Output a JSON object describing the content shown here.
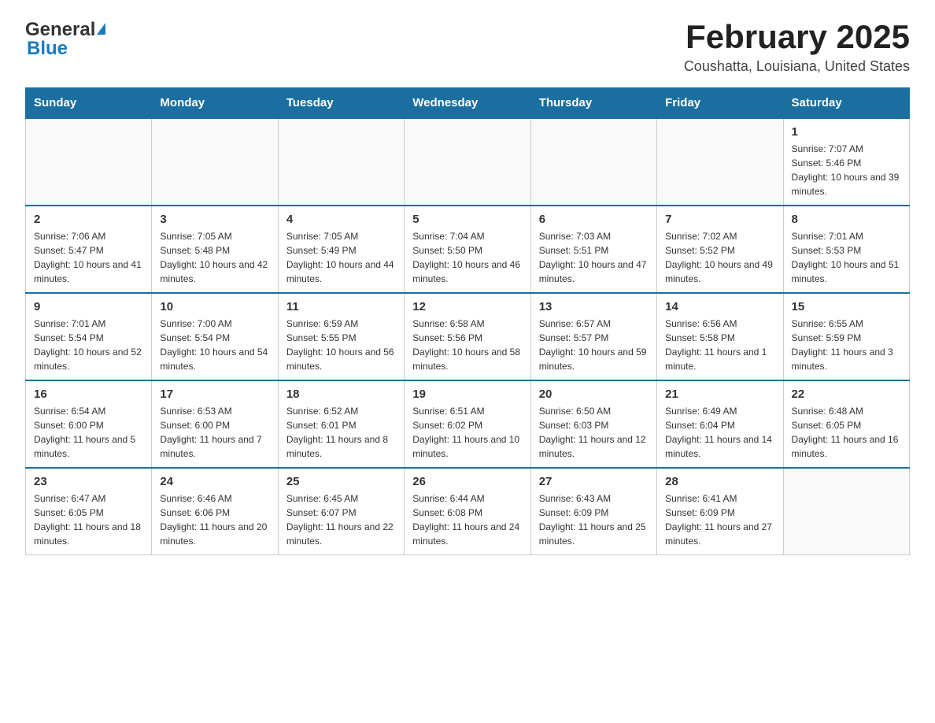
{
  "logo": {
    "general": "General",
    "blue": "Blue",
    "triangle": "▲"
  },
  "title": "February 2025",
  "subtitle": "Coushatta, Louisiana, United States",
  "days_of_week": [
    "Sunday",
    "Monday",
    "Tuesday",
    "Wednesday",
    "Thursday",
    "Friday",
    "Saturday"
  ],
  "weeks": [
    [
      {
        "day": "",
        "info": ""
      },
      {
        "day": "",
        "info": ""
      },
      {
        "day": "",
        "info": ""
      },
      {
        "day": "",
        "info": ""
      },
      {
        "day": "",
        "info": ""
      },
      {
        "day": "",
        "info": ""
      },
      {
        "day": "1",
        "info": "Sunrise: 7:07 AM\nSunset: 5:46 PM\nDaylight: 10 hours and 39 minutes."
      }
    ],
    [
      {
        "day": "2",
        "info": "Sunrise: 7:06 AM\nSunset: 5:47 PM\nDaylight: 10 hours and 41 minutes."
      },
      {
        "day": "3",
        "info": "Sunrise: 7:05 AM\nSunset: 5:48 PM\nDaylight: 10 hours and 42 minutes."
      },
      {
        "day": "4",
        "info": "Sunrise: 7:05 AM\nSunset: 5:49 PM\nDaylight: 10 hours and 44 minutes."
      },
      {
        "day": "5",
        "info": "Sunrise: 7:04 AM\nSunset: 5:50 PM\nDaylight: 10 hours and 46 minutes."
      },
      {
        "day": "6",
        "info": "Sunrise: 7:03 AM\nSunset: 5:51 PM\nDaylight: 10 hours and 47 minutes."
      },
      {
        "day": "7",
        "info": "Sunrise: 7:02 AM\nSunset: 5:52 PM\nDaylight: 10 hours and 49 minutes."
      },
      {
        "day": "8",
        "info": "Sunrise: 7:01 AM\nSunset: 5:53 PM\nDaylight: 10 hours and 51 minutes."
      }
    ],
    [
      {
        "day": "9",
        "info": "Sunrise: 7:01 AM\nSunset: 5:54 PM\nDaylight: 10 hours and 52 minutes."
      },
      {
        "day": "10",
        "info": "Sunrise: 7:00 AM\nSunset: 5:54 PM\nDaylight: 10 hours and 54 minutes."
      },
      {
        "day": "11",
        "info": "Sunrise: 6:59 AM\nSunset: 5:55 PM\nDaylight: 10 hours and 56 minutes."
      },
      {
        "day": "12",
        "info": "Sunrise: 6:58 AM\nSunset: 5:56 PM\nDaylight: 10 hours and 58 minutes."
      },
      {
        "day": "13",
        "info": "Sunrise: 6:57 AM\nSunset: 5:57 PM\nDaylight: 10 hours and 59 minutes."
      },
      {
        "day": "14",
        "info": "Sunrise: 6:56 AM\nSunset: 5:58 PM\nDaylight: 11 hours and 1 minute."
      },
      {
        "day": "15",
        "info": "Sunrise: 6:55 AM\nSunset: 5:59 PM\nDaylight: 11 hours and 3 minutes."
      }
    ],
    [
      {
        "day": "16",
        "info": "Sunrise: 6:54 AM\nSunset: 6:00 PM\nDaylight: 11 hours and 5 minutes."
      },
      {
        "day": "17",
        "info": "Sunrise: 6:53 AM\nSunset: 6:00 PM\nDaylight: 11 hours and 7 minutes."
      },
      {
        "day": "18",
        "info": "Sunrise: 6:52 AM\nSunset: 6:01 PM\nDaylight: 11 hours and 8 minutes."
      },
      {
        "day": "19",
        "info": "Sunrise: 6:51 AM\nSunset: 6:02 PM\nDaylight: 11 hours and 10 minutes."
      },
      {
        "day": "20",
        "info": "Sunrise: 6:50 AM\nSunset: 6:03 PM\nDaylight: 11 hours and 12 minutes."
      },
      {
        "day": "21",
        "info": "Sunrise: 6:49 AM\nSunset: 6:04 PM\nDaylight: 11 hours and 14 minutes."
      },
      {
        "day": "22",
        "info": "Sunrise: 6:48 AM\nSunset: 6:05 PM\nDaylight: 11 hours and 16 minutes."
      }
    ],
    [
      {
        "day": "23",
        "info": "Sunrise: 6:47 AM\nSunset: 6:05 PM\nDaylight: 11 hours and 18 minutes."
      },
      {
        "day": "24",
        "info": "Sunrise: 6:46 AM\nSunset: 6:06 PM\nDaylight: 11 hours and 20 minutes."
      },
      {
        "day": "25",
        "info": "Sunrise: 6:45 AM\nSunset: 6:07 PM\nDaylight: 11 hours and 22 minutes."
      },
      {
        "day": "26",
        "info": "Sunrise: 6:44 AM\nSunset: 6:08 PM\nDaylight: 11 hours and 24 minutes."
      },
      {
        "day": "27",
        "info": "Sunrise: 6:43 AM\nSunset: 6:09 PM\nDaylight: 11 hours and 25 minutes."
      },
      {
        "day": "28",
        "info": "Sunrise: 6:41 AM\nSunset: 6:09 PM\nDaylight: 11 hours and 27 minutes."
      },
      {
        "day": "",
        "info": ""
      }
    ]
  ],
  "colors": {
    "header_bg": "#1a6fa0",
    "header_text": "#ffffff",
    "border": "#cccccc",
    "accent_blue": "#1a7bbf"
  }
}
